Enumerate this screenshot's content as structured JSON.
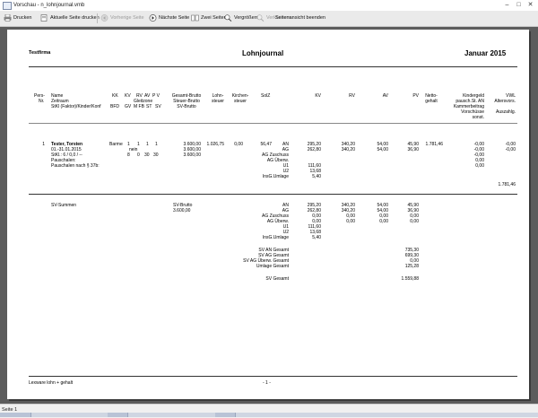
{
  "window": {
    "title": "Vorschau - n_lohnjournal.vmb",
    "minimize": "–",
    "maximize": "□",
    "close": "✕"
  },
  "toolbar": {
    "print": "Drucken",
    "print_current": "Aktuelle Seite drucken",
    "prev": "Vorherige Seite",
    "next": "Nächste Seite",
    "two_pages": "Zwei Seiten",
    "zoom_in": "Vergrößern",
    "zoom_out": "Verkleinern",
    "close_preview": "Seitenansicht beenden"
  },
  "report": {
    "company": "Testfirma",
    "title": "Lohnjournal",
    "period": "Januar 2015",
    "headers": {
      "pers": "Pers-",
      "nr": "Nr.",
      "name1": "Name",
      "name2": "Zeitraum",
      "name3": "StKl (Faktor)/Kinder/Konf",
      "kk": "KK",
      "bfd": "BFD",
      "kv": "KV",
      "gv": "GV",
      "rv": "RV",
      "av": "AV",
      "pv": "P V",
      "gleitzone": "Gleitzone",
      "mfb": "M FB",
      "st": "ST",
      "sv": "SV",
      "gesamt1": "Gesamt-Brutto",
      "gesamt2": "Steuer-Brutto",
      "gesamt3": "SV-Brutto",
      "lohn1": "Lohn-",
      "lohn2": "steuer",
      "kirch1": "Kirchen-",
      "kirch2": "steuer",
      "solz": "SolZ",
      "col_kv": "KV",
      "col_rv": "RV",
      "col_av": "AV",
      "col_pv": "PV",
      "netto1": "Netto-",
      "netto2": "gehalt",
      "kg1": "Kindergeld",
      "kg2": "pausch.St. AN",
      "kg3": "Kammerbeitrag",
      "kg4": "Vorschüsse",
      "kg5": "sonst.",
      "vwl1": "VWL",
      "vwl2": "Altersvors.",
      "vwl3": "Auszahlg."
    },
    "employee": {
      "nr": "1",
      "name": "Tester, Torsten",
      "period": "01.-31.01.2015",
      "stkl": "StKl.: 6 / 0,0 / --",
      "pausch1": "Pauschalen:",
      "pausch2": "Pauschalen nach § 37b:",
      "kk": "Barme",
      "kv": "1",
      "rv": "1",
      "av": "1",
      "pv": "1",
      "nein": "nein",
      "gv": "8",
      "mfb": "0",
      "st": "30",
      "sv": "30",
      "gesamt": "3.600,00",
      "steuer": "3.600,00",
      "svbrutto": "3.600,00",
      "lohnsteuer": "1.026,75",
      "kirchensteuer": "0,00",
      "solz": "56,47",
      "rows": [
        {
          "label": "AN",
          "kv": "295,20",
          "rv": "340,20",
          "av": "54,00",
          "pv": "45,90"
        },
        {
          "label": "AG",
          "kv": "262,80",
          "rv": "340,20",
          "av": "54,00",
          "pv": "36,90"
        },
        {
          "label": "AG Zuschuss",
          "kv": "",
          "rv": "",
          "av": "",
          "pv": ""
        },
        {
          "label": "AG Überw.",
          "kv": "",
          "rv": "",
          "av": "",
          "pv": ""
        },
        {
          "label": "U1",
          "kv": "111,60",
          "rv": "",
          "av": "",
          "pv": ""
        },
        {
          "label": "U2",
          "kv": "13,68",
          "rv": "",
          "av": "",
          "pv": ""
        },
        {
          "label": "InsG.Umlage",
          "kv": "5,40",
          "rv": "",
          "av": "",
          "pv": ""
        }
      ],
      "netto": "1.781,46",
      "kindergeld": [
        "-0,00",
        "-0,00",
        "-0,00",
        "0,00",
        "0,00"
      ],
      "vwl": [
        "-0,00",
        "-0,00"
      ],
      "auszahlung": "1.781,46"
    },
    "sv": {
      "label": "SV-Summen",
      "brutto_label": "SV-Brutto",
      "brutto": "3.600,00",
      "rows": [
        {
          "label": "AN",
          "kv": "295,20",
          "rv": "340,20",
          "av": "54,00",
          "pv": "45,90"
        },
        {
          "label": "AG",
          "kv": "262,80",
          "rv": "340,20",
          "av": "54,00",
          "pv": "36,90"
        },
        {
          "label": "AG Zuschuss",
          "kv": "0,00",
          "rv": "0,00",
          "av": "0,00",
          "pv": "0,00"
        },
        {
          "label": "AG Überw.",
          "kv": "0,00",
          "rv": "0,00",
          "av": "0,00",
          "pv": "0,00"
        },
        {
          "label": "U1",
          "kv": "111,60",
          "rv": "",
          "av": "",
          "pv": ""
        },
        {
          "label": "U2",
          "kv": "13,68",
          "rv": "",
          "av": "",
          "pv": ""
        },
        {
          "label": "InsG.Umlage",
          "kv": "5,40",
          "rv": "",
          "av": "",
          "pv": ""
        }
      ],
      "totals": [
        {
          "label": "SV AN Gesamt",
          "value": "735,30"
        },
        {
          "label": "SV AG Gesamt",
          "value": "699,30"
        },
        {
          "label": "SV AG Überw. Gesamt",
          "value": "0,00"
        },
        {
          "label": "Umlage Gesamt",
          "value": "125,28"
        }
      ],
      "grand_label": "SV Gesamt",
      "grand": "1.559,88"
    },
    "footer": {
      "left": "Lexware lohn + gehalt",
      "page": "- 1 -"
    }
  },
  "status": {
    "page": "Seite 1"
  }
}
